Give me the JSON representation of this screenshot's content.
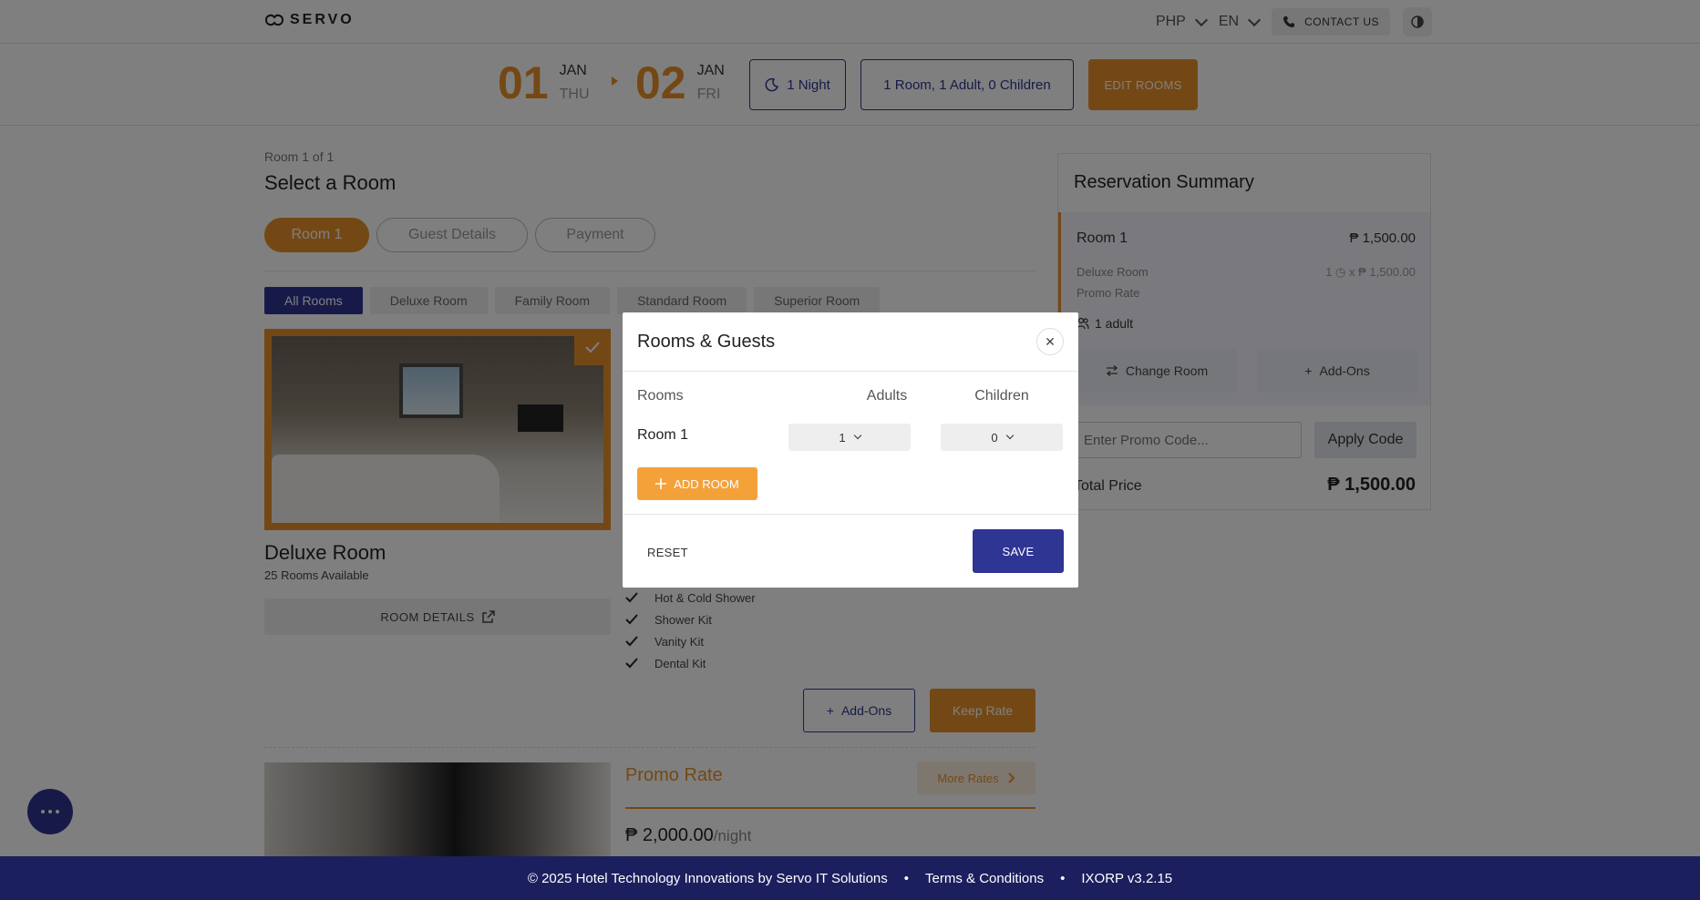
{
  "header": {
    "brand": "SERVO",
    "currency": "PHP",
    "language": "EN",
    "contact_label": "CONTACT US"
  },
  "booking_bar": {
    "checkin_day": "01",
    "checkin_month": "JAN",
    "checkin_weekday": "THU",
    "checkout_day": "02",
    "checkout_month": "JAN",
    "checkout_weekday": "FRI",
    "nights": "1 Night",
    "guests": "1 Room, 1 Adult, 0 Children",
    "edit_label": "EDIT ROOMS"
  },
  "main": {
    "room_counter": "Room 1 of 1",
    "title": "Select a Room",
    "steps": [
      "Room 1",
      "Guest Details",
      "Payment"
    ],
    "filters": [
      "All Rooms",
      "Deluxe Room",
      "Family Room",
      "Standard Room",
      "Superior Room"
    ],
    "room": {
      "name": "Deluxe Room",
      "availability": "25 Rooms Available",
      "details_label": "ROOM DETAILS",
      "amenities": [
        "Hot & Cold Shower",
        "Shower Kit",
        "Vanity Kit",
        "Dental Kit"
      ],
      "addons_label": "Add-Ons",
      "keep_label": "Keep Rate"
    },
    "rate2": {
      "title": "Promo Rate",
      "more_label": "More Rates",
      "price": "₱ 2,000.00",
      "per": "/night"
    }
  },
  "summary": {
    "title": "Reservation Summary",
    "room_name": "Room 1",
    "room_price": "₱ 1,500.00",
    "room_type": "Deluxe Room",
    "qty": "1 ◷ x ₱ 1,500.00",
    "rate_name": "Promo Rate",
    "adults": "1 adult",
    "change_label": "Change Room",
    "addons_label": "Add-Ons",
    "promo_placeholder": "Enter Promo Code...",
    "apply_label": "Apply Code",
    "total_label": "Total Price",
    "total_value": "₱ 1,500.00"
  },
  "modal": {
    "title": "Rooms & Guests",
    "col_rooms": "Rooms",
    "col_adults": "Adults",
    "col_children": "Children",
    "rows": [
      {
        "room": "Room 1",
        "adults": "1",
        "children": "0"
      }
    ],
    "add_room_label": "ADD ROOM",
    "reset_label": "RESET",
    "save_label": "SAVE"
  },
  "footer": {
    "copyright": "© 2025 Hotel Technology Innovations by Servo IT Solutions",
    "terms": "Terms & Conditions",
    "version": "IXORP v3.2.15",
    "sep": "•"
  },
  "colors": {
    "accent": "#e8912a",
    "brand": "#2f3593",
    "footer": "#1c1f5e"
  }
}
